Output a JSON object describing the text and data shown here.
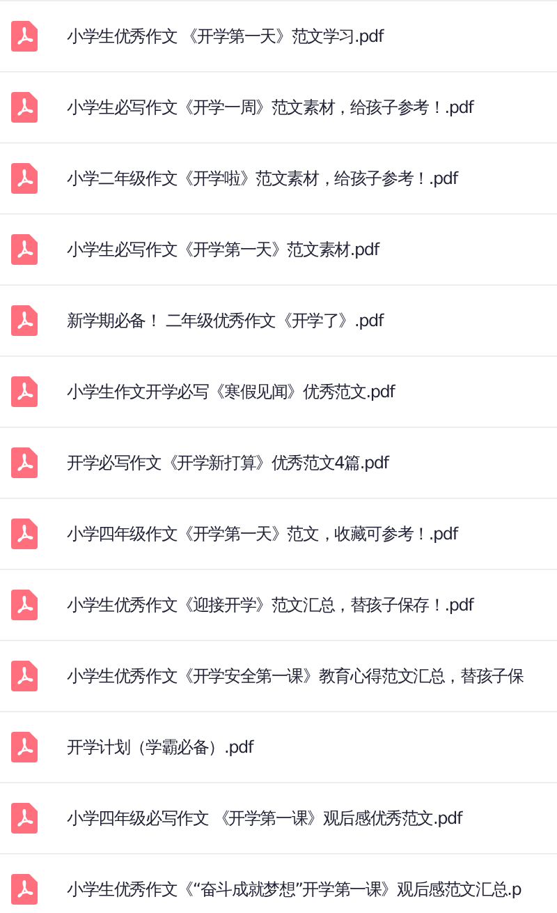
{
  "files": [
    {
      "name": "小学生优秀作文 《开学第一天》范文学习.pdf"
    },
    {
      "name": "小学生必写作文《开学一周》范文素材，给孩子参考！.pdf"
    },
    {
      "name": "小学二年级作文《开学啦》范文素材，给孩子参考！.pdf"
    },
    {
      "name": "小学生必写作文《开学第一天》范文素材.pdf"
    },
    {
      "name": "新学期必备！ 二年级优秀作文《开学了》.pdf"
    },
    {
      "name": "小学生作文开学必写《寒假见闻》优秀范文.pdf"
    },
    {
      "name": "开学必写作文《开学新打算》优秀范文4篇.pdf"
    },
    {
      "name": "小学四年级作文《开学第一天》范文，收藏可参考！.pdf"
    },
    {
      "name": "小学生优秀作文《迎接开学》范文汇总，替孩子保存！.pdf"
    },
    {
      "name": "小学生优秀作文《开学安全第一课》教育心得范文汇总，替孩子保"
    },
    {
      "name": "开学计划（学霸必备）.pdf"
    },
    {
      "name": "小学四年级必写作文 《开学第一课》观后感优秀范文.pdf"
    },
    {
      "name": "小学生优秀作文《“奋斗成就梦想”开学第一课》观后感范文汇总.p"
    }
  ]
}
